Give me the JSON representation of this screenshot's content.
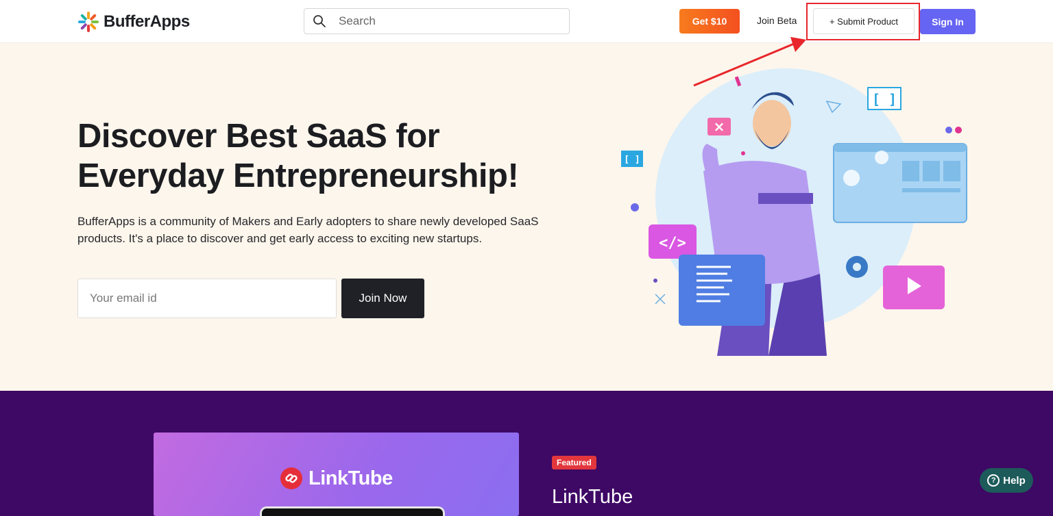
{
  "header": {
    "brand": "BufferApps",
    "search_placeholder": "Search",
    "get_button": "Get $10",
    "beta_link": "Join Beta",
    "submit_button": "+ Submit Product",
    "signin_button": "Sign In"
  },
  "hero": {
    "title_line1": "Discover Best SaaS for",
    "title_line2": "Everyday Entrepreneurship!",
    "description": "BufferApps is a community of Makers and Early adopters to share newly developed SaaS products. It's a place to discover and get early access to exciting new startups.",
    "email_placeholder": "Your email id",
    "join_button": "Join Now"
  },
  "featured": {
    "card_logo_text": "LinkTube",
    "badge": "Featured",
    "product_name": "LinkTube"
  },
  "help_button": "Help",
  "colors": {
    "accent_orange": "#f4501f",
    "accent_purple": "#6664f2",
    "hero_bg": "#fdf6ec",
    "featured_bg": "#3e0865",
    "highlight_red": "#e8262c"
  }
}
